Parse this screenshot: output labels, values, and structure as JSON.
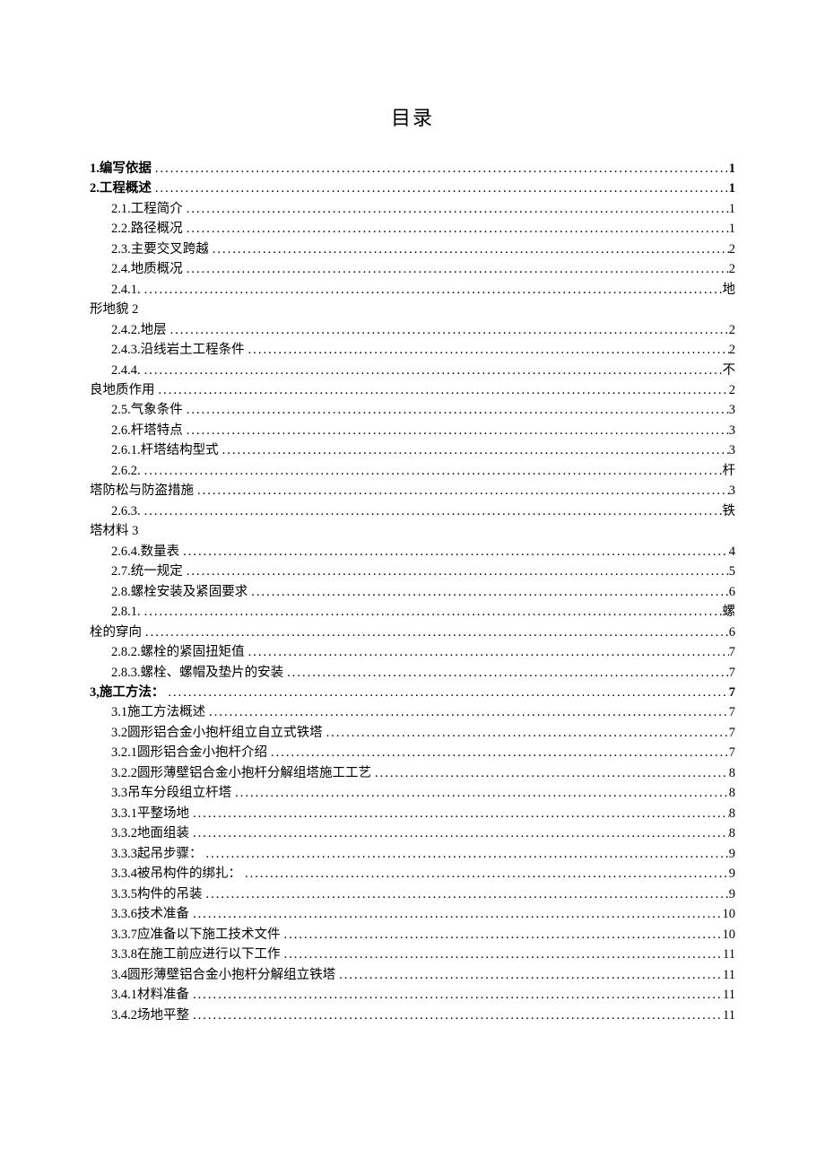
{
  "title": "目录",
  "entries": [
    {
      "indent": 0,
      "bold": true,
      "num": "1",
      "label": " .编写依据",
      "page": "1",
      "pageBold": true
    },
    {
      "indent": 0,
      "bold": true,
      "num": "2",
      "label": " .工程概述",
      "page": "1",
      "pageBold": true
    },
    {
      "indent": 1,
      "bold": false,
      "num": "2.1. ",
      "label": "工程简介",
      "page": "1"
    },
    {
      "indent": 1,
      "bold": false,
      "num": "2.2. ",
      "label": "路径概况",
      "page": "1"
    },
    {
      "indent": 1,
      "bold": false,
      "num": "2.3. ",
      "label": "主要交叉跨越",
      "page": "2"
    },
    {
      "indent": 1,
      "bold": false,
      "num": "2.4. ",
      "label": "地质概况",
      "page": "2"
    },
    {
      "indent": 1,
      "bold": false,
      "num": "2.4.1.",
      "label": "",
      "page": "地"
    },
    {
      "indent": 0,
      "bold": false,
      "num": "",
      "label": "形地貌   2",
      "page": "",
      "noDots": true
    },
    {
      "indent": 1,
      "bold": false,
      "num": "2.4.2.",
      "label": "地层",
      "page": "2"
    },
    {
      "indent": 1,
      "bold": false,
      "num": "2.4.3.",
      "label": "沿线岩土工程条件",
      "page": "2"
    },
    {
      "indent": 1,
      "bold": false,
      "num": "2.4.4.",
      "label": "",
      "page": "不"
    },
    {
      "indent": 0,
      "bold": false,
      "num": "",
      "label": "良地质作用",
      "page": "2"
    },
    {
      "indent": 1,
      "bold": false,
      "num": "2.5. ",
      "label": "气象条件",
      "page": "3"
    },
    {
      "indent": 1,
      "bold": false,
      "num": "2.6. ",
      "label": "杆塔特点",
      "page": "3"
    },
    {
      "indent": 1,
      "bold": false,
      "num": "2.6.1.",
      "label": "杆塔结构型式",
      "page": "3"
    },
    {
      "indent": 1,
      "bold": false,
      "num": "2.6.2.",
      "label": "",
      "page": "杆"
    },
    {
      "indent": 0,
      "bold": false,
      "num": "",
      "label": "塔防松与防盗措施",
      "page": "3"
    },
    {
      "indent": 1,
      "bold": false,
      "num": "2.6.3.",
      "label": "",
      "page": "铁"
    },
    {
      "indent": 0,
      "bold": false,
      "num": "",
      "label": "塔材料   3",
      "page": "",
      "noDots": true
    },
    {
      "indent": 1,
      "bold": false,
      "num": "2.6.4.",
      "label": "数量表",
      "page": "4"
    },
    {
      "indent": 1,
      "bold": false,
      "num": "2.7. ",
      "label": "统一规定",
      "page": "5"
    },
    {
      "indent": 1,
      "bold": false,
      "num": "2.8. ",
      "label": "螺栓安装及紧固要求",
      "page": "6"
    },
    {
      "indent": 1,
      "bold": false,
      "num": "2.8.1.",
      "label": "",
      "page": "螺"
    },
    {
      "indent": 0,
      "bold": false,
      "num": "",
      "label": "栓的穿向",
      "page": "6"
    },
    {
      "indent": 1,
      "bold": false,
      "num": "2.8.2.",
      "label": "螺栓的紧固扭矩值",
      "page": "7"
    },
    {
      "indent": 1,
      "bold": false,
      "num": "2.8.3.",
      "label": "螺栓、螺帽及垫片的安装",
      "page": "7"
    },
    {
      "indent": 0,
      "bold": true,
      "num": "3,",
      "label": "施工方法：",
      "page": "7",
      "pageBold": true
    },
    {
      "indent": 1,
      "bold": false,
      "num": "3.1 ",
      "label": "施工方法概述",
      "page": "7"
    },
    {
      "indent": 1,
      "bold": false,
      "num": "3.2 ",
      "label": "圆形铝合金小抱杆组立自立式铁塔",
      "page": "7"
    },
    {
      "indent": 1,
      "bold": false,
      "num": "3.2.1",
      "label": "圆形铝合金小抱杆介绍 ",
      "page": "7"
    },
    {
      "indent": 1,
      "bold": false,
      "num": "3.2.2",
      "label": "圆形薄壁铝合金小抱杆分解组塔施工工艺 ",
      "page": "8"
    },
    {
      "indent": 1,
      "bold": false,
      "num": "3.3 ",
      "label": "吊车分段组立杆塔",
      "page": "8"
    },
    {
      "indent": 1,
      "bold": false,
      "num": "3.3.1",
      "label": "平整场地 ",
      "page": "8"
    },
    {
      "indent": 1,
      "bold": false,
      "num": "3.3.2",
      "label": "地面组装 ",
      "page": "8"
    },
    {
      "indent": 1,
      "bold": false,
      "num": "3.3.3",
      "label": "起吊步骤： ",
      "page": "9"
    },
    {
      "indent": 1,
      "bold": false,
      "num": "3.3.4",
      "label": "被吊构件的绑扎： ",
      "page": "9"
    },
    {
      "indent": 1,
      "bold": false,
      "num": "3.3.5",
      "label": "构件的吊装 ",
      "page": "9"
    },
    {
      "indent": 1,
      "bold": false,
      "num": "3.3.6",
      "label": "技术准备 ",
      "page": "10"
    },
    {
      "indent": 1,
      "bold": false,
      "num": "3.3.7",
      "label": "应准备以下施工技术文件 ",
      "page": "10"
    },
    {
      "indent": 1,
      "bold": false,
      "num": "3.3.8",
      "label": "在施工前应进行以下工作 ",
      "page": "11"
    },
    {
      "indent": 1,
      "bold": false,
      "num": "3.4 ",
      "label": "圆形薄壁铝合金小抱杆分解组立铁塔",
      "page": "11"
    },
    {
      "indent": 1,
      "bold": false,
      "num": "3.4.1",
      "label": "材料准备 ",
      "page": "11"
    },
    {
      "indent": 1,
      "bold": false,
      "num": "3.4.2",
      "label": "场地平整 ",
      "page": "11"
    }
  ]
}
